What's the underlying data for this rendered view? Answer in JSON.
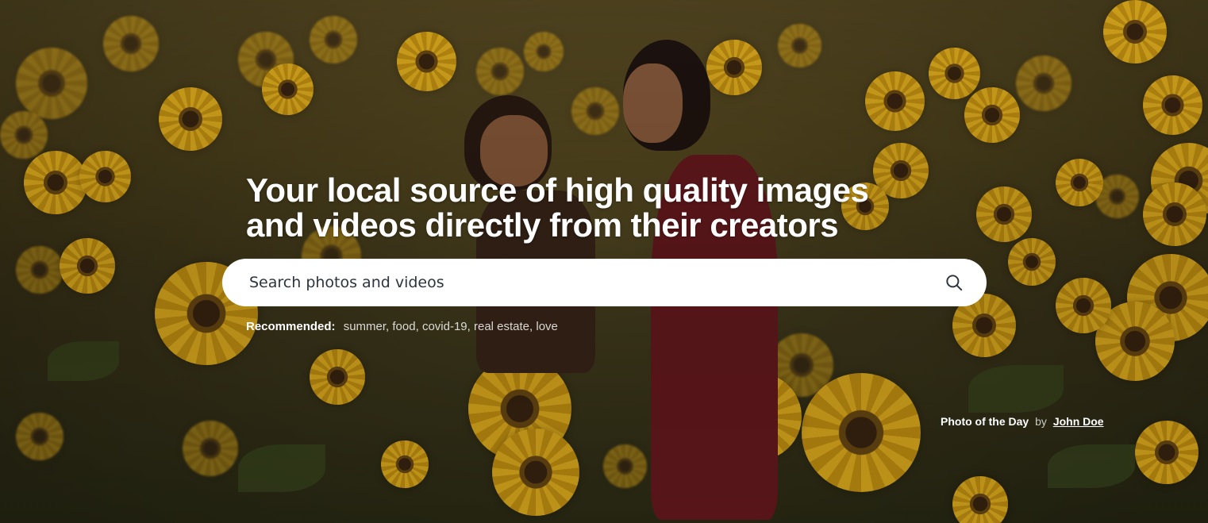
{
  "hero": {
    "headline_line1": "Your local source of high quality images",
    "headline_line2": "and videos directly from their creators",
    "background_subject": "sunflower-field-photo"
  },
  "search": {
    "placeholder": "Search photos and videos",
    "value": "",
    "icon": "search-icon"
  },
  "recommended": {
    "label": "Recommended:",
    "tags": [
      "summer",
      "food",
      "covid-19",
      "real estate",
      "love"
    ],
    "separator": ", "
  },
  "credit": {
    "title": "Photo of the Day",
    "by": "by",
    "author": "John Doe"
  },
  "colors": {
    "accent_white": "#ffffff",
    "search_text": "#2c343e",
    "sunflower_yellow": "#e6b21e"
  }
}
